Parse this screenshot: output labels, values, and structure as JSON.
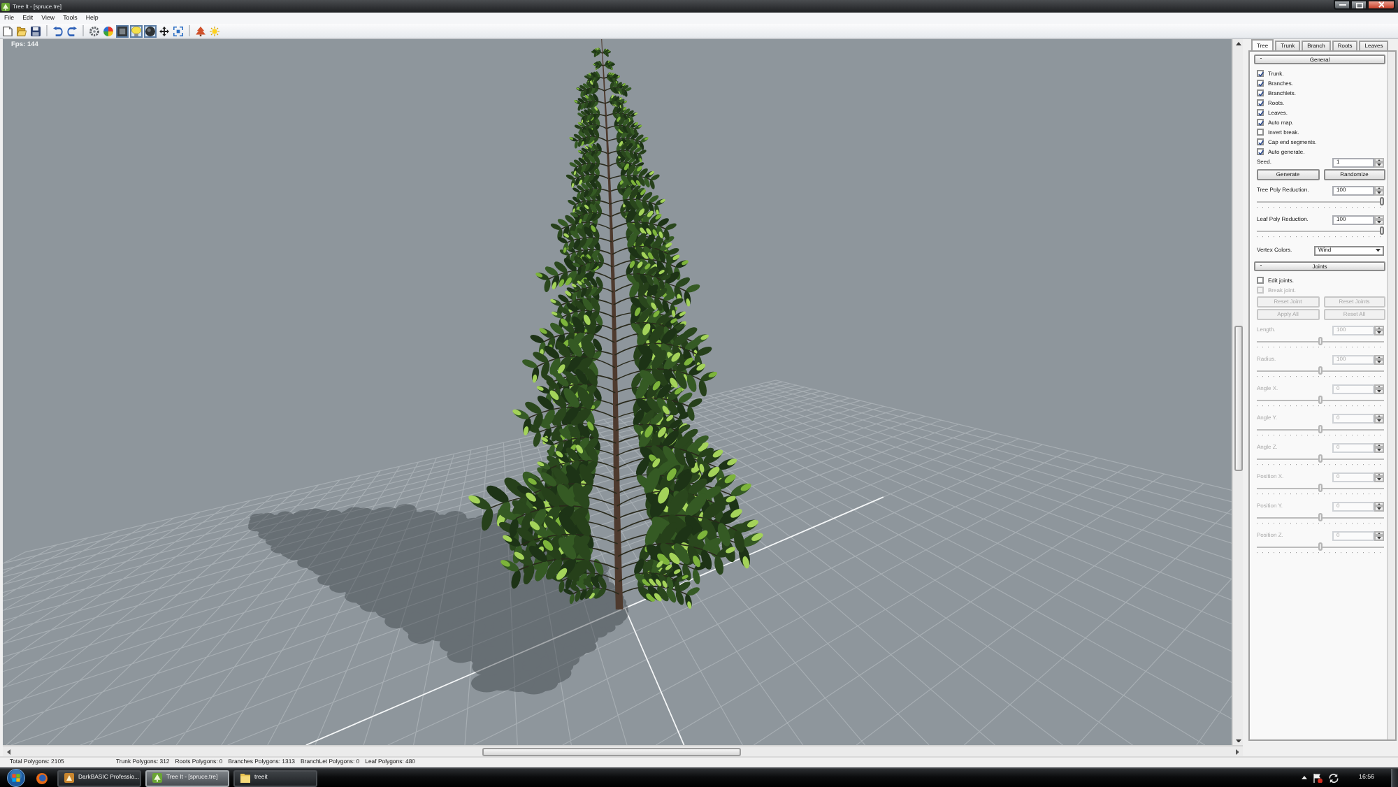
{
  "window": {
    "title": "Tree It - [spruce.tre]"
  },
  "menu": [
    "File",
    "Edit",
    "View",
    "Tools",
    "Help"
  ],
  "toolbar_groups": [
    [
      {
        "pressed": false
      },
      {
        "pressed": false
      },
      {
        "pressed": false
      }
    ],
    [
      {
        "pressed": false
      },
      {
        "pressed": false
      }
    ],
    [
      {
        "pressed": false
      },
      {
        "pressed": false
      },
      {
        "pressed": true
      },
      {
        "pressed": true
      },
      {
        "pressed": true
      },
      {
        "pressed": false
      },
      {
        "pressed": false
      }
    ],
    [
      {
        "pressed": false
      },
      {
        "pressed": false
      }
    ]
  ],
  "viewport": {
    "fps": "Fps: 144"
  },
  "panel": {
    "tabs": [
      {
        "label": "Tree",
        "selected": true
      },
      {
        "label": "Trunk",
        "selected": false
      },
      {
        "label": "Branch",
        "selected": false
      },
      {
        "label": "Roots",
        "selected": false
      },
      {
        "label": "Leaves",
        "selected": false
      }
    ],
    "sections": [
      {
        "toggle": "-",
        "title": "General",
        "controls": [
          {
            "kind": "checkbox",
            "label": "Trunk.",
            "checked": true,
            "disabled": false
          },
          {
            "kind": "checkbox",
            "label": "Branches.",
            "checked": true,
            "disabled": false
          },
          {
            "kind": "checkbox",
            "label": "Branchlets.",
            "checked": true,
            "disabled": false
          },
          {
            "kind": "checkbox",
            "label": "Roots.",
            "checked": true,
            "disabled": false
          },
          {
            "kind": "checkbox",
            "label": "Leaves.",
            "checked": true,
            "disabled": false
          },
          {
            "kind": "checkbox",
            "label": "Auto map.",
            "checked": true,
            "disabled": false
          },
          {
            "kind": "checkbox",
            "label": "Invert break.",
            "checked": false,
            "disabled": false
          },
          {
            "kind": "checkbox",
            "label": "Cap end segments.",
            "checked": true,
            "disabled": false
          },
          {
            "kind": "checkbox",
            "label": "Auto generate.",
            "checked": true,
            "disabled": false
          },
          {
            "kind": "spin",
            "label": "Seed.",
            "value": "1"
          },
          {
            "kind": "buttons",
            "buttons": [
              {
                "label": "Generate",
                "disabled": false
              },
              {
                "label": "Randomize",
                "disabled": false
              }
            ]
          },
          {
            "kind": "spin-slider",
            "label": "Tree Poly Reduction.",
            "value": "100",
            "level": 1,
            "disabled": false
          },
          {
            "kind": "spin-slider",
            "label": "Leaf Poly Reduction.",
            "value": "100",
            "level": 1,
            "disabled": false
          },
          {
            "kind": "dropdown",
            "label": "Vertex Colors.",
            "value": "Wind"
          }
        ]
      },
      {
        "toggle": "-",
        "title": "Joints",
        "controls": [
          {
            "kind": "checkbox",
            "label": "Edit joints.",
            "checked": false,
            "disabled": false
          },
          {
            "kind": "checkbox",
            "label": "Break joint.",
            "checked": false,
            "disabled": true
          },
          {
            "kind": "buttons",
            "buttons": [
              {
                "label": "Reset Joint",
                "disabled": true
              },
              {
                "label": "Reset Joints",
                "disabled": true
              }
            ]
          },
          {
            "kind": "buttons",
            "buttons": [
              {
                "label": "Apply All",
                "disabled": true
              },
              {
                "label": "Reset All",
                "disabled": true
              }
            ]
          },
          {
            "kind": "spin-slider",
            "label": "Length.",
            "value": "100",
            "level": 0.5,
            "disabled": true
          },
          {
            "kind": "spin-slider",
            "label": "Radius.",
            "value": "100",
            "level": 0.5,
            "disabled": true
          },
          {
            "kind": "spin-slider",
            "label": "Angle X.",
            "value": "0",
            "level": 0.5,
            "disabled": true
          },
          {
            "kind": "spin-slider",
            "label": "Angle Y.",
            "value": "0",
            "level": 0.5,
            "disabled": true
          },
          {
            "kind": "spin-slider",
            "label": "Angle Z.",
            "value": "0",
            "level": 0.5,
            "disabled": true
          },
          {
            "kind": "spin-slider",
            "label": "Position X.",
            "value": "0",
            "level": 0.5,
            "disabled": true
          },
          {
            "kind": "spin-slider",
            "label": "Position Y.",
            "value": "0",
            "level": 0.5,
            "disabled": true
          },
          {
            "kind": "spin-slider",
            "label": "Position Z.",
            "value": "0",
            "level": 0.5,
            "disabled": true
          }
        ]
      }
    ]
  },
  "status_bar": {
    "total": "Total Polygons: 2105",
    "counts": [
      "Trunk Polygons: 312",
      "Roots Polygons: 0",
      "Branches Polygons: 1313",
      "BranchLet Polygons: 0",
      "Leaf Polygons: 480"
    ]
  },
  "taskbar": {
    "tasks": [
      {
        "label": "DarkBASIC Professio...",
        "selected": false
      },
      {
        "label": "Tree It - [spruce.tre]",
        "selected": true
      },
      {
        "label": "treeit",
        "selected": false
      }
    ],
    "clock": "16:56"
  }
}
